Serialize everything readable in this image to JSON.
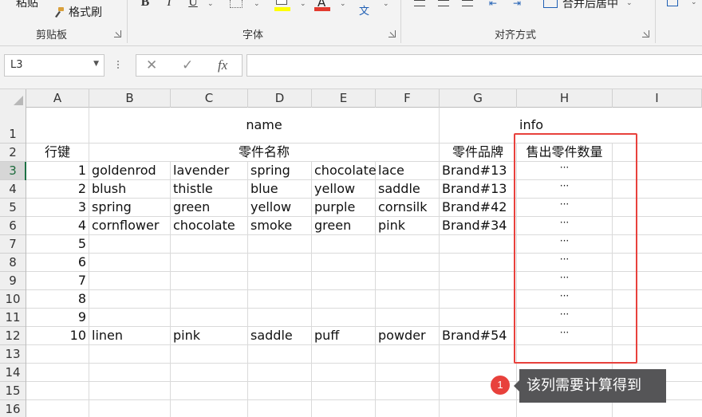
{
  "ribbon": {
    "clipboard": {
      "paste_label": "粘贴",
      "format_painter_label": "格式刷",
      "group_name": "剪贴板"
    },
    "font": {
      "bold": "B",
      "italic": "I",
      "underline": "U",
      "group_name": "字体",
      "font_color_letter": "A",
      "phonetic_glyph": "文"
    },
    "alignment": {
      "merge_label": "合并后居中",
      "group_name": "对齐方式"
    }
  },
  "formula_bar": {
    "name_box": "L3",
    "fx_label": "fx",
    "formula": ""
  },
  "grid": {
    "columns": [
      "A",
      "B",
      "C",
      "D",
      "E",
      "F",
      "G",
      "H",
      "I"
    ],
    "rows": [
      "1",
      "2",
      "3",
      "4",
      "5",
      "6",
      "7",
      "8",
      "9",
      "10",
      "11",
      "12",
      "13",
      "14",
      "15",
      "16"
    ],
    "headers": {
      "name": "name",
      "info": "info",
      "row_key": "行键",
      "part_name": "零件名称",
      "part_brand": "零件品牌",
      "sold_qty": "售出零件数量"
    },
    "data_rows": [
      {
        "id": "1",
        "parts": [
          "goldenrod",
          "lavender",
          "spring",
          "chocolate",
          "lace"
        ],
        "brand": "Brand#13",
        "qty": "···"
      },
      {
        "id": "2",
        "parts": [
          "blush",
          "thistle",
          "blue",
          "yellow",
          "saddle"
        ],
        "brand": "Brand#13",
        "qty": "···"
      },
      {
        "id": "3",
        "parts": [
          "spring",
          "green",
          "yellow",
          "purple",
          "cornsilk"
        ],
        "brand": "Brand#42",
        "qty": "···"
      },
      {
        "id": "4",
        "parts": [
          "cornflower",
          "chocolate",
          "smoke",
          "green",
          "pink"
        ],
        "brand": "Brand#34",
        "qty": "···"
      },
      {
        "id": "5",
        "parts": [
          "",
          "",
          "",
          "",
          ""
        ],
        "brand": "",
        "qty": "···"
      },
      {
        "id": "6",
        "parts": [
          "",
          "",
          "",
          "",
          ""
        ],
        "brand": "",
        "qty": "···"
      },
      {
        "id": "7",
        "parts": [
          "",
          "",
          "",
          "",
          ""
        ],
        "brand": "",
        "qty": "···"
      },
      {
        "id": "8",
        "parts": [
          "",
          "",
          "",
          "",
          ""
        ],
        "brand": "",
        "qty": "···"
      },
      {
        "id": "9",
        "parts": [
          "",
          "",
          "",
          "",
          ""
        ],
        "brand": "",
        "qty": "···"
      },
      {
        "id": "10",
        "parts": [
          "linen",
          "pink",
          "saddle",
          "puff",
          "powder"
        ],
        "brand": "Brand#54",
        "qty": "···"
      }
    ]
  },
  "annotation": {
    "badge": "1",
    "tooltip": "该列需要计算得到"
  },
  "colors": {
    "highlight": "#e8413c",
    "tooltip_bg": "#555557",
    "selected_row": "#1e7145"
  }
}
